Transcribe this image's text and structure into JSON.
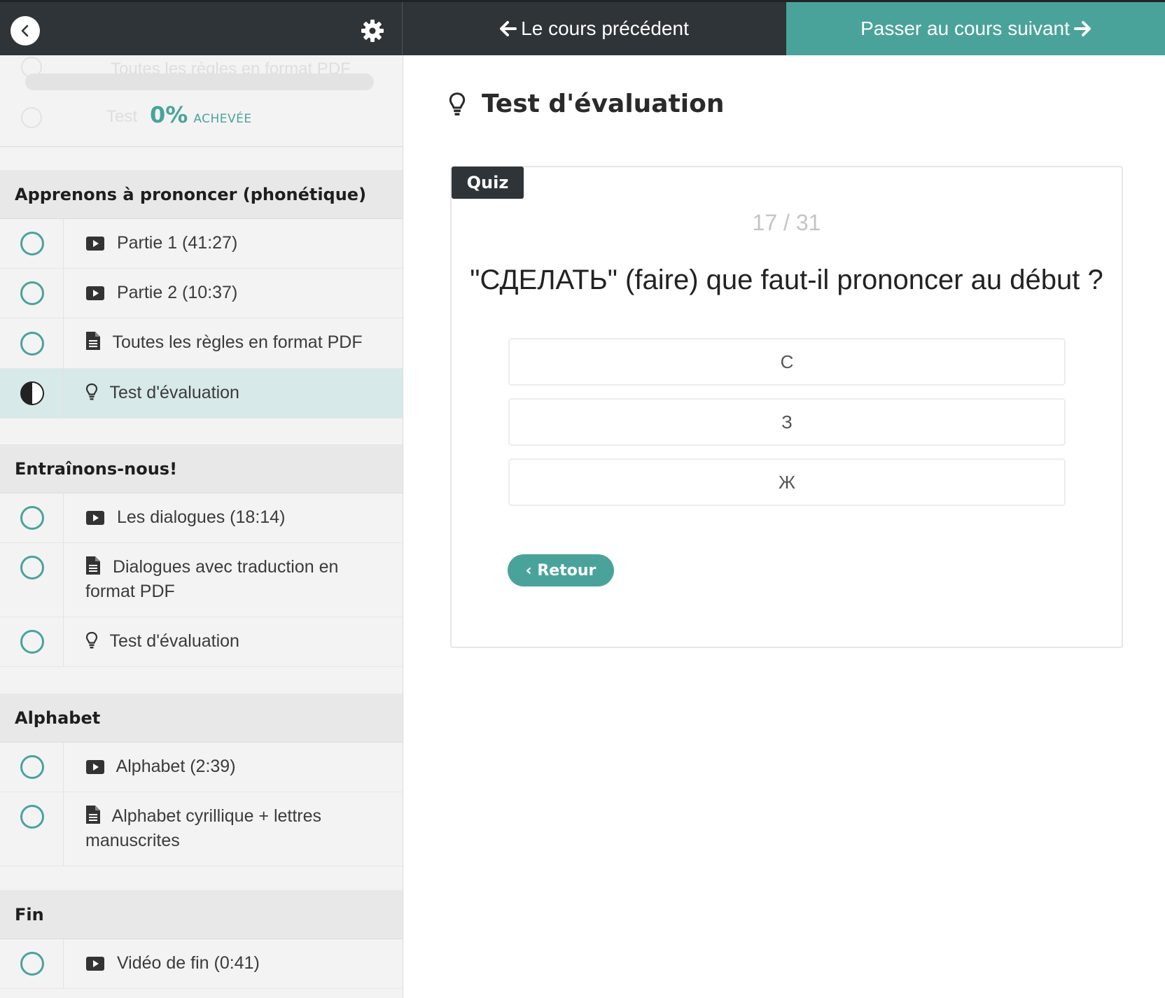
{
  "topbar": {
    "prev_label": "Le cours précédent",
    "next_label": "Passer au cours suivant"
  },
  "progress": {
    "ghost_pdf": "Toutes les règles en format PDF",
    "ghost_test": "Test",
    "percent": "0%",
    "label": "ACHEVÉE",
    "value": 0
  },
  "sections": [
    {
      "title": "Apprenons à prononcer (phonétique)",
      "lessons": [
        {
          "icon": "video-icon",
          "title": "Partie 1 (41:27)",
          "status": "not-started"
        },
        {
          "icon": "video-icon",
          "title": "Partie 2 (10:37)",
          "status": "not-started"
        },
        {
          "icon": "document-icon",
          "title": "Toutes les règles en format PDF",
          "status": "not-started"
        },
        {
          "icon": "lightbulb-icon",
          "title": "Test d'évaluation",
          "status": "in-progress",
          "active": true
        }
      ]
    },
    {
      "title": "Entraînons-nous!",
      "lessons": [
        {
          "icon": "video-icon",
          "title": "Les dialogues (18:14)",
          "status": "not-started"
        },
        {
          "icon": "document-icon",
          "title": "Dialogues avec traduction en format PDF",
          "status": "not-started"
        },
        {
          "icon": "lightbulb-icon",
          "title": "Test d'évaluation",
          "status": "not-started"
        }
      ]
    },
    {
      "title": "Alphabet",
      "lessons": [
        {
          "icon": "video-icon",
          "title": "Alphabet (2:39)",
          "status": "not-started"
        },
        {
          "icon": "document-icon",
          "title": "Alphabet cyrillique + lettres manuscrites",
          "status": "not-started"
        }
      ]
    },
    {
      "title": "Fin",
      "lessons": [
        {
          "icon": "video-icon",
          "title": "Vidéo de fin (0:41)",
          "status": "not-started"
        }
      ]
    }
  ],
  "main": {
    "lesson_title": "Test d'évaluation",
    "quiz_tag": "Quiz",
    "quiz_count": "17 / 31",
    "question": "\"СДЕЛАТЬ\" (faire) que faut-il prononcer au début ?",
    "answers": [
      "С",
      "З",
      "Ж"
    ],
    "back_label": "‹ Retour"
  },
  "colors": {
    "accent": "#4aa39b",
    "topbar": "#2e3437",
    "active_row": "#d7e9e8"
  }
}
